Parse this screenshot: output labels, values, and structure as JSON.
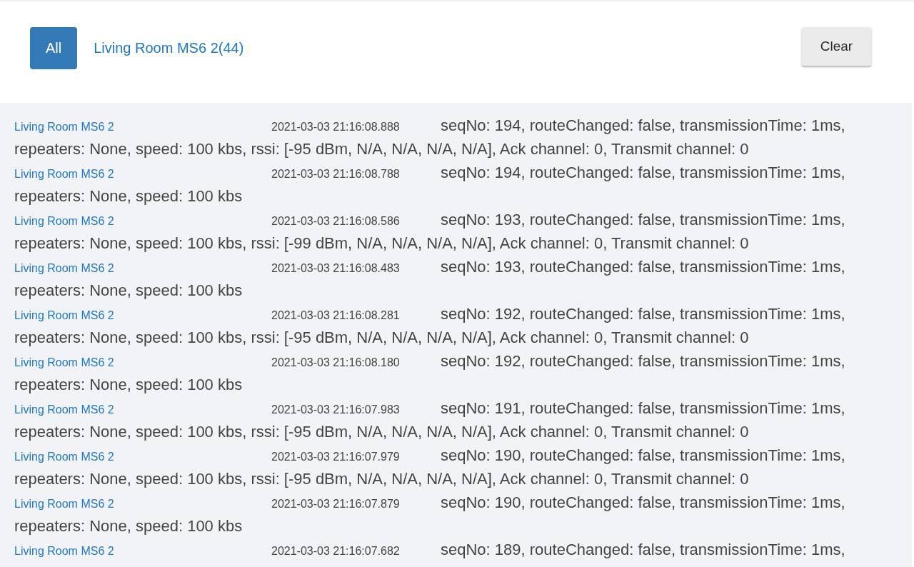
{
  "filter_bar": {
    "tabs": [
      {
        "label": "All",
        "selected": true
      },
      {
        "label": "Living Room MS6 2(44)",
        "selected": false
      }
    ],
    "clear_button": "Clear"
  },
  "log": [
    {
      "device": "Living Room MS6 2",
      "timestamp": "2021-03-03 21:16:08.888",
      "message_lines": [
        "seqNo: 194, routeChanged: false, transmissionTime: 1ms,",
        "repeaters: None, speed: 100 kbs, rssi: [-95 dBm, N/A, N/A, N/A, N/A], Ack channel: 0, Transmit channel: 0"
      ]
    },
    {
      "device": "Living Room MS6 2",
      "timestamp": "2021-03-03 21:16:08.788",
      "message_lines": [
        "seqNo: 194, routeChanged: false, transmissionTime: 1ms,",
        "repeaters: None, speed: 100 kbs"
      ]
    },
    {
      "device": "Living Room MS6 2",
      "timestamp": "2021-03-03 21:16:08.586",
      "message_lines": [
        "seqNo: 193, routeChanged: false, transmissionTime: 1ms,",
        "repeaters: None, speed: 100 kbs, rssi: [-99 dBm, N/A, N/A, N/A, N/A], Ack channel: 0, Transmit channel: 0"
      ]
    },
    {
      "device": "Living Room MS6 2",
      "timestamp": "2021-03-03 21:16:08.483",
      "message_lines": [
        "seqNo: 193, routeChanged: false, transmissionTime: 1ms,",
        "repeaters: None, speed: 100 kbs"
      ]
    },
    {
      "device": "Living Room MS6 2",
      "timestamp": "2021-03-03 21:16:08.281",
      "message_lines": [
        "seqNo: 192, routeChanged: false, transmissionTime: 1ms,",
        "repeaters: None, speed: 100 kbs, rssi: [-95 dBm, N/A, N/A, N/A, N/A], Ack channel: 0, Transmit channel: 0"
      ]
    },
    {
      "device": "Living Room MS6 2",
      "timestamp": "2021-03-03 21:16:08.180",
      "message_lines": [
        "seqNo: 192, routeChanged: false, transmissionTime: 1ms,",
        "repeaters: None, speed: 100 kbs"
      ]
    },
    {
      "device": "Living Room MS6 2",
      "timestamp": "2021-03-03 21:16:07.983",
      "message_lines": [
        "seqNo: 191, routeChanged: false, transmissionTime: 1ms,",
        "repeaters: None, speed: 100 kbs, rssi: [-95 dBm, N/A, N/A, N/A, N/A], Ack channel: 0, Transmit channel: 0"
      ]
    },
    {
      "device": "Living Room MS6 2",
      "timestamp": "2021-03-03 21:16:07.979",
      "message_lines": [
        "seqNo: 190, routeChanged: false, transmissionTime: 1ms,",
        "repeaters: None, speed: 100 kbs, rssi: [-95 dBm, N/A, N/A, N/A, N/A], Ack channel: 0, Transmit channel: 0"
      ]
    },
    {
      "device": "Living Room MS6 2",
      "timestamp": "2021-03-03 21:16:07.879",
      "message_lines": [
        "seqNo: 190, routeChanged: false, transmissionTime: 1ms,",
        "repeaters: None, speed: 100 kbs"
      ]
    },
    {
      "device": "Living Room MS6 2",
      "timestamp": "2021-03-03 21:16:07.682",
      "message_lines": [
        "seqNo: 189, routeChanged: false, transmissionTime: 1ms,"
      ]
    }
  ]
}
